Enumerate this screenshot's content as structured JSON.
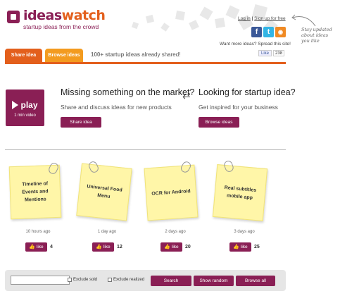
{
  "header": {
    "logo_part1": "ideas",
    "logo_part2": "watch",
    "tagline": "startup ideas from the crowd",
    "login": "Log in",
    "separator": "|",
    "signup": "Sign up for free",
    "spread": "Want more ideas? Spread this site!",
    "fb_like": "Like",
    "fb_count": "238",
    "note": "Stay updated about ideas you like"
  },
  "social": [
    "f",
    "t",
    "rss"
  ],
  "tabs": {
    "share": "Share idea",
    "browse": "Browse ideas",
    "headline_count": "100+ startup ideas",
    "headline_rest": " already shared!"
  },
  "hero": {
    "play": "play",
    "duration": "1 min video",
    "left_title": "Missing something on the market?",
    "left_sub": "Share and discuss ideas for new products",
    "left_button": "Share idea",
    "right_title": "Looking for startup idea?",
    "right_sub": "Get inspired for your business",
    "right_button": "Browse ideas"
  },
  "ideas": [
    {
      "title": "Timeline of Events and Mentions",
      "ago": "10 hours ago",
      "likes": "4"
    },
    {
      "title": "Universal Food Menu",
      "ago": "1 day ago",
      "likes": "12"
    },
    {
      "title": "OCR for Android",
      "ago": "2 days ago",
      "likes": "20"
    },
    {
      "title": "Real subtitles mobile app",
      "ago": "3 days ago",
      "likes": "25"
    }
  ],
  "like_label": "like",
  "bottom": {
    "search_value": "",
    "exclude_sold": "Exclude sold",
    "exclude_realized": "Exclude realized",
    "search": "Search",
    "random": "Show random",
    "browse_all": "Browse all"
  },
  "colors": {
    "brand": "#8a1f55",
    "accent": "#e35f1c",
    "tab2": "#f39b1f",
    "note": "#fff6a8"
  }
}
